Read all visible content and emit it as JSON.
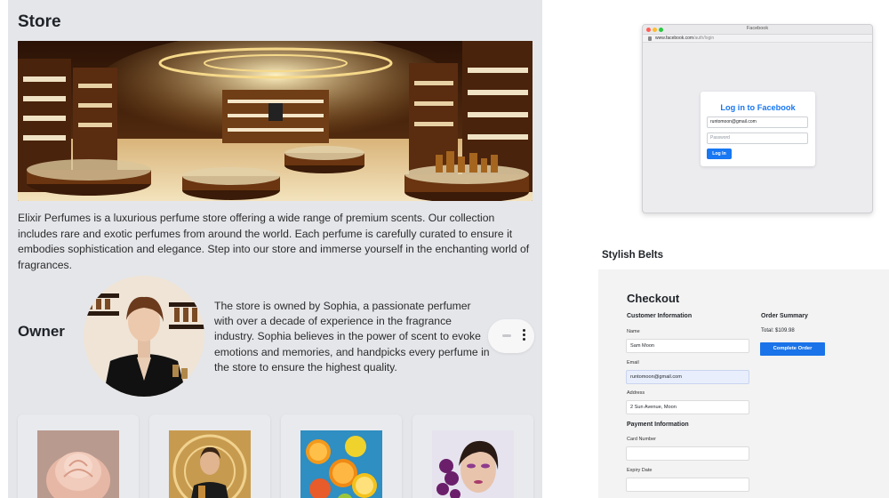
{
  "store": {
    "title": "Store",
    "description": "Elixir Perfumes is a luxurious perfume store offering a wide range of premium scents. Our collection includes rare and exotic perfumes from around the world. Each perfume is carefully curated to ensure it embodies sophistication and elegance. Step into our store and immerse yourself in the enchanting world of fragrances.",
    "owner_heading": "Owner",
    "owner_bio": "The store is owned by Sophia, a passionate perfumer with over a decade of experience in the fragrance industry. Sophia believes in the power of scent to evoke emotions and memories, and handpicks every perfume in the store to ensure the highest quality."
  },
  "facebook": {
    "window_title": "Facebook",
    "url_host": "www.facebook.com",
    "url_path": "/auth/login",
    "heading": "Log in to Facebook",
    "email_value": "runtomoon@gmail.com",
    "password_placeholder": "Password",
    "login_button": "Log In",
    "brand_color": "#1877f2"
  },
  "checkout": {
    "section_title": "Stylish Belts",
    "title": "Checkout",
    "customer_heading": "Customer Information",
    "name_label": "Name",
    "name_value": "Sam Moon",
    "email_label": "Email",
    "email_value": "runtomoon@gmail.com",
    "address_label": "Address",
    "address_value": "2 Sun Avenue, Moon",
    "payment_heading": "Payment Information",
    "card_label": "Card Number",
    "card_value": "",
    "expiry_label": "Expiry Date",
    "expiry_value": "",
    "summary_heading": "Order Summary",
    "total": "Total: $109.98",
    "complete_button": "Complete Order",
    "accent_color": "#1a73e8"
  },
  "icons": [
    "drag-handle-icon",
    "more-vertical-icon",
    "lock-icon"
  ]
}
